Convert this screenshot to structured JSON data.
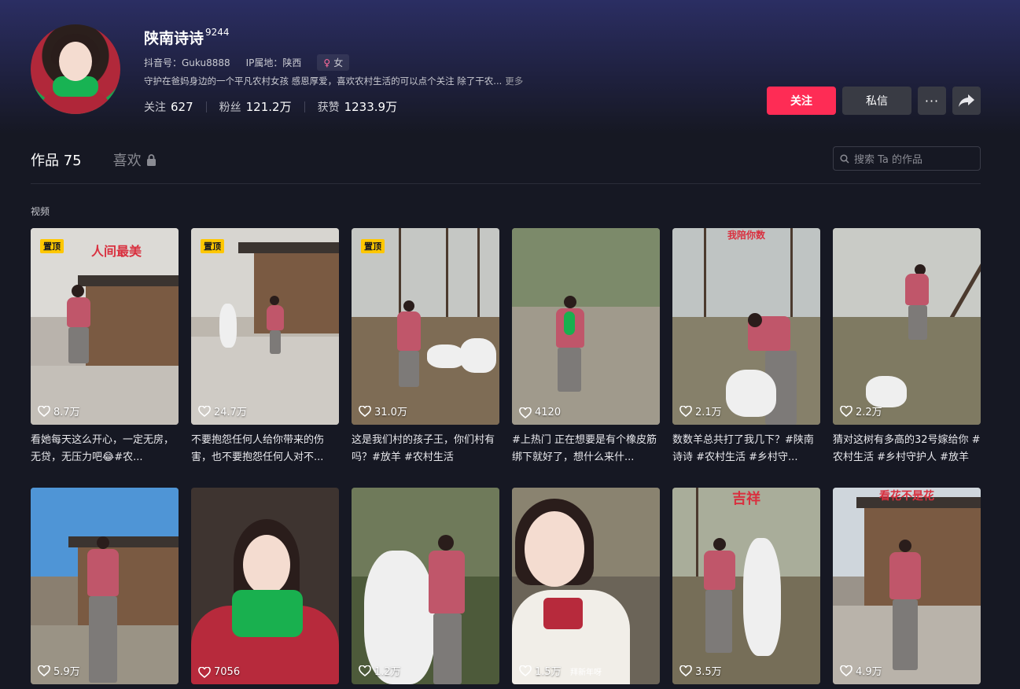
{
  "profile": {
    "name": "陕南诗诗",
    "level": "9244",
    "douyin_id": "抖音号：Guku8888",
    "ip": "IP属地：陕西",
    "gender": "女",
    "bio": "守护在爸妈身边的一个平凡农村女孩 感恩厚爱，喜欢农村生活的可以点个关注 除了干农...",
    "more": "更多",
    "stats": [
      {
        "label": "关注",
        "value": "627"
      },
      {
        "label": "粉丝",
        "value": "121.2万"
      },
      {
        "label": "获赞",
        "value": "1233.9万"
      }
    ]
  },
  "actions": {
    "follow": "关注",
    "message": "私信",
    "more": "···"
  },
  "tabs": {
    "works_label": "作品",
    "works_count": "75",
    "likes_label": "喜欢"
  },
  "search": {
    "placeholder": "搜索 Ta 的作品"
  },
  "section_label": "视频",
  "pin_label": "置顶",
  "videos": [
    {
      "likes": "8.7万",
      "caption": "看她每天这么开心，一定无房，无贷，无压力吧😂#农...",
      "overlay": "人间最美",
      "pinned": true
    },
    {
      "likes": "24.7万",
      "caption": "不要抱怨任何人给你带来的伤害，也不要抱怨任何人对不...",
      "overlay": "",
      "pinned": true
    },
    {
      "likes": "31.0万",
      "caption": "这是我们村的孩子王，你们村有吗？#放羊 #农村生活",
      "overlay": "",
      "pinned": true
    },
    {
      "likes": "4120",
      "caption": "#上热门 正在想要是有个橡皮筋绑下就好了，想什么来什...",
      "overlay": "",
      "pinned": false
    },
    {
      "likes": "2.1万",
      "caption": "数数羊总共打了我几下？#陕南诗诗 #农村生活 #乡村守...",
      "overlay": "我陪你数",
      "pinned": false
    },
    {
      "likes": "2.2万",
      "caption": "猜对这树有多高的32号嫁给你 #农村生活 #乡村守护人 #放羊",
      "overlay": "",
      "pinned": false
    },
    {
      "likes": "5.9万",
      "caption": "",
      "overlay": "",
      "pinned": false
    },
    {
      "likes": "7056",
      "caption": "",
      "overlay": "",
      "pinned": false
    },
    {
      "likes": "1.2万",
      "caption": "",
      "overlay": "",
      "pinned": false
    },
    {
      "likes": "1.5万",
      "caption": "",
      "overlay": "拜新年呀",
      "pinned": false
    },
    {
      "likes": "3.5万",
      "caption": "",
      "overlay": "吉祥",
      "pinned": false
    },
    {
      "likes": "4.9万",
      "caption": "",
      "overlay": "看花不是花",
      "pinned": false
    }
  ]
}
